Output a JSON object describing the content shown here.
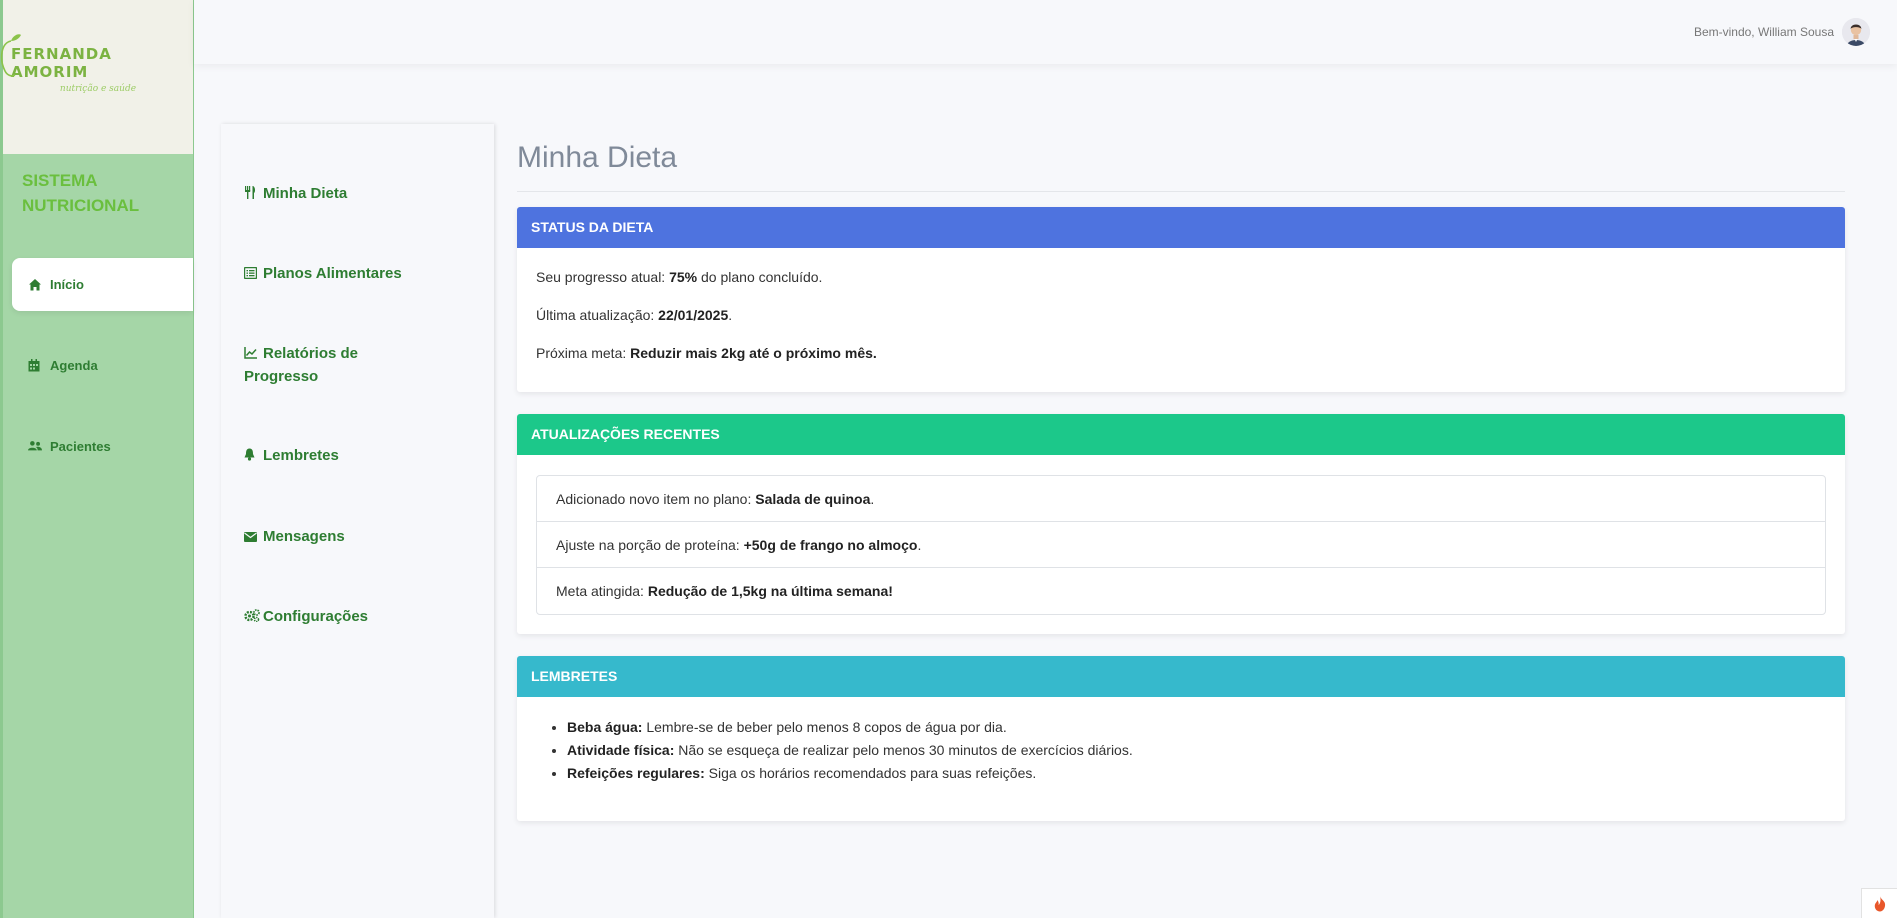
{
  "brand": {
    "name": "FERNANDA AMORIM",
    "tagline": "nutrição e saúde",
    "system_title_line1": "SISTEMA",
    "system_title_line2": "NUTRICIONAL",
    "logo_color": "#7cb342"
  },
  "sidebar": {
    "items": [
      {
        "label": "Início",
        "icon": "home-icon",
        "active": true
      },
      {
        "label": "Agenda",
        "icon": "calendar-icon",
        "active": false
      },
      {
        "label": "Pacientes",
        "icon": "users-icon",
        "active": false
      }
    ]
  },
  "header": {
    "welcome": "Bem-vindo, William Sousa"
  },
  "submenu": {
    "items": [
      {
        "label": "Minha Dieta",
        "icon": "utensils-icon"
      },
      {
        "label": "Planos Alimentares",
        "icon": "list-alt-icon"
      },
      {
        "label": "Relatórios de Progresso",
        "icon": "chart-line-icon"
      },
      {
        "label": "Lembretes",
        "icon": "bell-icon"
      },
      {
        "label": "Mensagens",
        "icon": "envelope-icon"
      },
      {
        "label": "Configurações",
        "icon": "cogs-icon"
      }
    ]
  },
  "main": {
    "title": "Minha Dieta",
    "status": {
      "header": "STATUS DA DIETA",
      "progress_prefix": "Seu progresso atual: ",
      "progress_value": "75%",
      "progress_suffix": " do plano concluído.",
      "updated_prefix": "Última atualização: ",
      "updated_value": "22/01/2025",
      "updated_suffix": ".",
      "goal_prefix": "Próxima meta: ",
      "goal_value": "Reduzir mais 2kg até o próximo mês."
    },
    "updates": {
      "header": "ATUALIZAÇÕES RECENTES",
      "items": [
        {
          "prefix": "Adicionado novo item no plano: ",
          "value": "Salada de quinoa",
          "suffix": "."
        },
        {
          "prefix": "Ajuste na porção de proteína: ",
          "value": "+50g de frango no almoço",
          "suffix": "."
        },
        {
          "prefix": "Meta atingida: ",
          "value": "Redução de 1,5kg na última semana!",
          "suffix": ""
        }
      ]
    },
    "reminders": {
      "header": "LEMBRETES",
      "items": [
        {
          "title": "Beba água:",
          "text": " Lembre-se de beber pelo menos 8 copos de água por dia."
        },
        {
          "title": "Atividade física:",
          "text": " Não se esqueça de realizar pelo menos 30 minutos de exercícios diários."
        },
        {
          "title": "Refeições regulares:",
          "text": " Siga os horários recomendados para suas refeições."
        }
      ]
    }
  },
  "colors": {
    "sidebar_bg": "#a5d6a7",
    "status_header": "#4e73df",
    "updates_header": "#1cc88a",
    "reminders_header": "#36b9cc",
    "nav_text": "#2e7d32"
  },
  "corner_button": {
    "icon": "fire-icon"
  }
}
